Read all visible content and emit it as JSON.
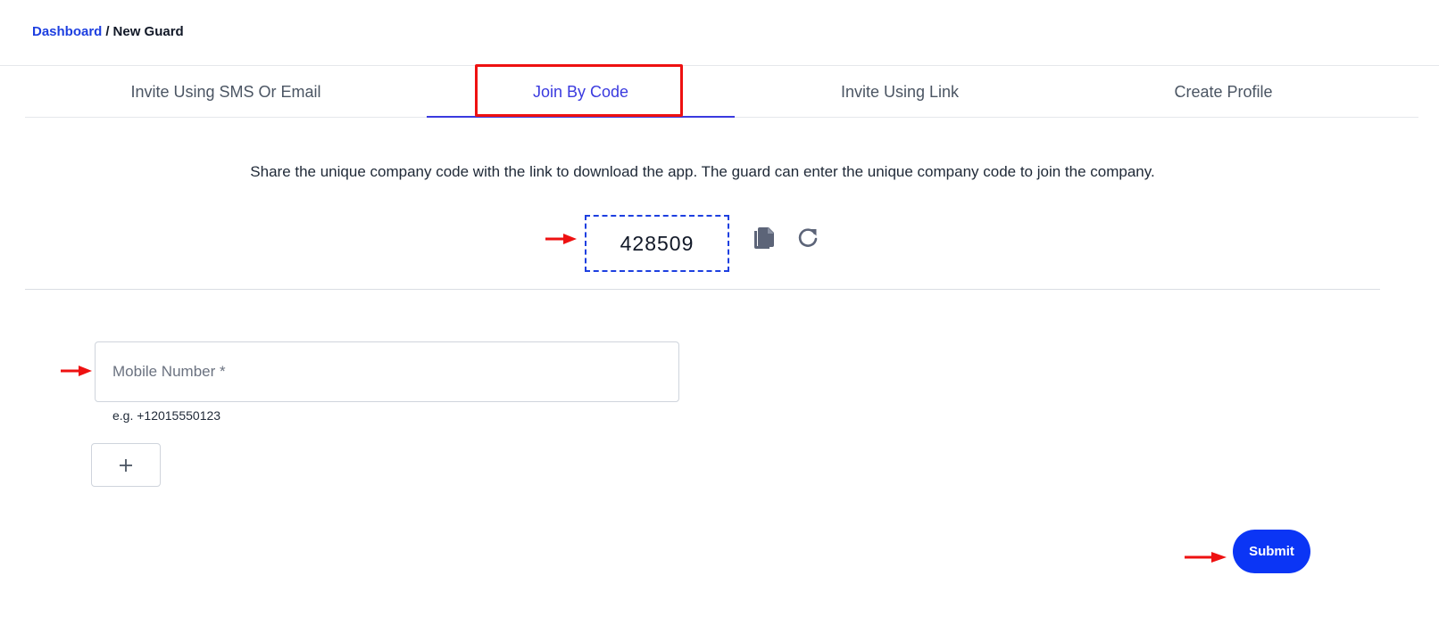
{
  "breadcrumb": {
    "parent": "Dashboard",
    "separator": "/",
    "current": "New Guard"
  },
  "tabs": [
    {
      "label": "Invite Using SMS Or Email",
      "active": false
    },
    {
      "label": "Join By Code",
      "active": true
    },
    {
      "label": "Invite Using Link",
      "active": false
    },
    {
      "label": "Create Profile",
      "active": false
    }
  ],
  "join_code": {
    "description": "Share the unique company code with the link to download the app. The guard can enter the unique company code to join the company.",
    "code": "428509",
    "copy_icon": "copy-icon",
    "refresh_icon": "refresh-icon"
  },
  "form": {
    "mobile_placeholder": "Mobile Number *",
    "mobile_value": "",
    "mobile_hint": "e.g. +12015550123",
    "add_label": "+",
    "submit_label": "Submit"
  },
  "colors": {
    "accent": "#3a3adf",
    "link": "#1d3fe0",
    "submit": "#0b35f5",
    "annotation": "#ee1111"
  }
}
